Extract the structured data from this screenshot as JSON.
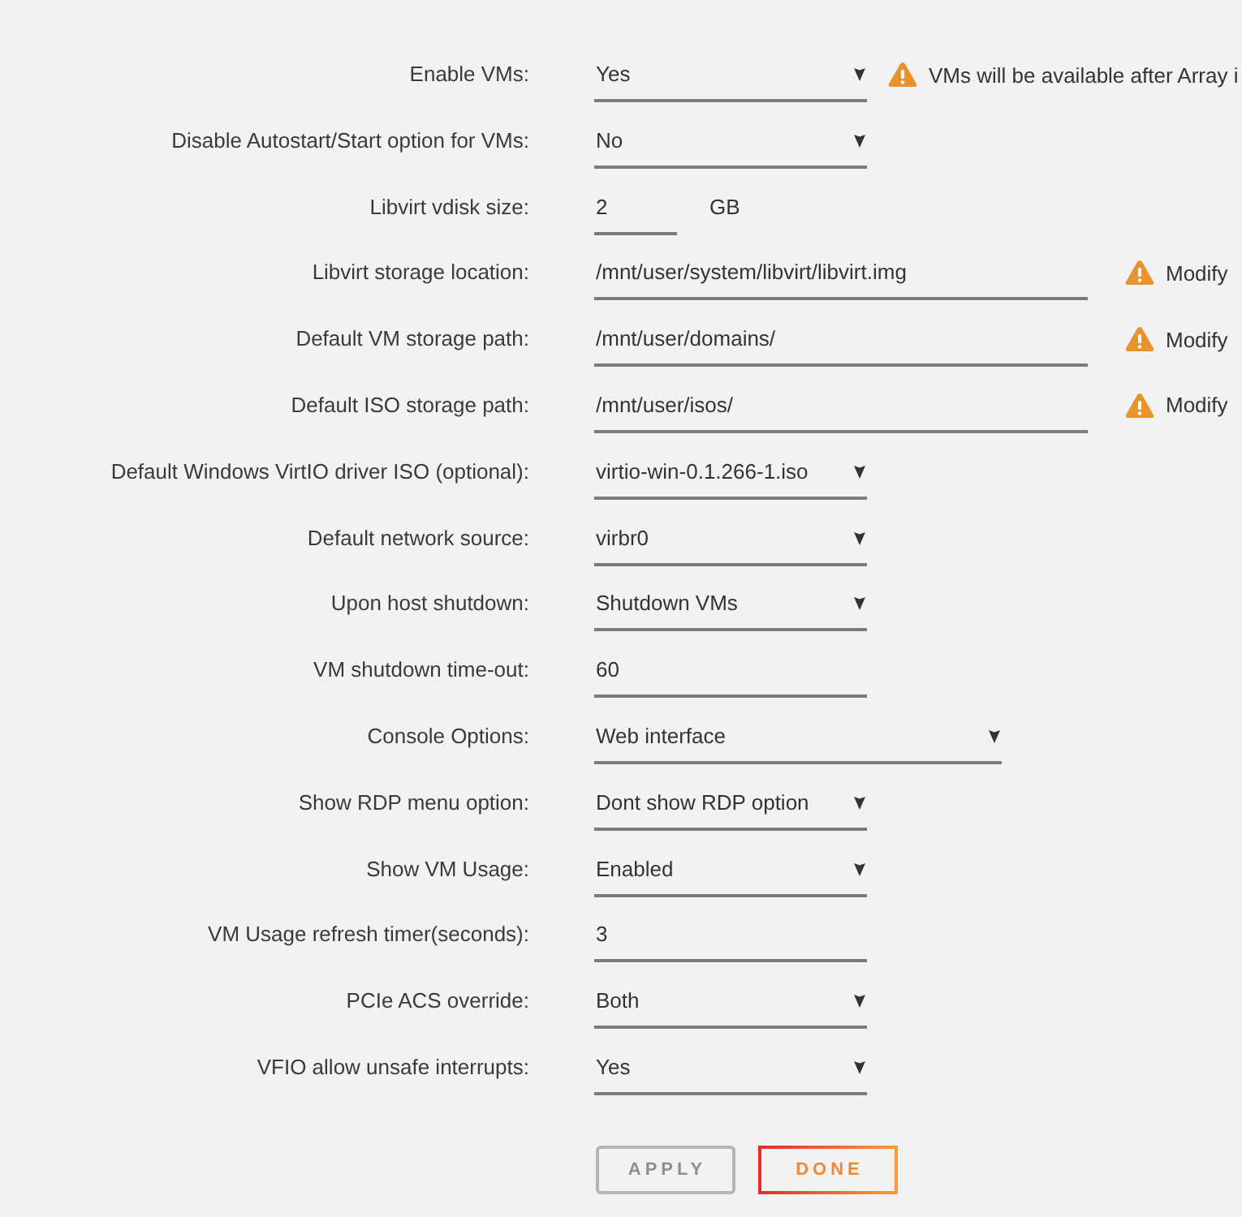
{
  "settings": [
    {
      "label": "Enable VMs:",
      "kind": "select",
      "value": "Yes",
      "note": "VMs will be available after Array i"
    },
    {
      "label": "Disable Autostart/Start option for VMs:",
      "kind": "select",
      "value": "No"
    },
    {
      "label": "Libvirt vdisk size:",
      "kind": "size",
      "value": "2",
      "unit": "GB"
    },
    {
      "label": "Libvirt storage location:",
      "kind": "path",
      "value": "/mnt/user/system/libvirt/libvirt.img",
      "note": "Modify"
    },
    {
      "label": "Default VM storage path:",
      "kind": "path",
      "value": "/mnt/user/domains/",
      "note": "Modify"
    },
    {
      "label": "Default ISO storage path:",
      "kind": "path",
      "value": "/mnt/user/isos/",
      "note": "Modify"
    },
    {
      "label": "Default Windows VirtIO driver ISO (optional):",
      "kind": "select",
      "value": "virtio-win-0.1.266-1.iso"
    },
    {
      "label": "Default network source:",
      "kind": "select",
      "value": "virbr0"
    },
    {
      "label": "Upon host shutdown:",
      "kind": "select",
      "value": "Shutdown VMs"
    },
    {
      "label": "VM shutdown time-out:",
      "kind": "text",
      "value": "60"
    },
    {
      "label": "Console Options:",
      "kind": "wideselect",
      "value": "Web interface"
    },
    {
      "label": "Show RDP menu option:",
      "kind": "select",
      "value": "Dont show RDP option"
    },
    {
      "label": "Show VM Usage:",
      "kind": "select",
      "value": "Enabled"
    },
    {
      "label": "VM Usage refresh timer(seconds):",
      "kind": "text",
      "value": "3"
    },
    {
      "label": "PCIe ACS override:",
      "kind": "select",
      "value": "Both"
    },
    {
      "label": "VFIO allow unsafe interrupts:",
      "kind": "select",
      "value": "Yes"
    }
  ],
  "buttons": [
    {
      "label": "APPLY",
      "disabled": true
    },
    {
      "label": "DONE",
      "disabled": false
    }
  ]
}
